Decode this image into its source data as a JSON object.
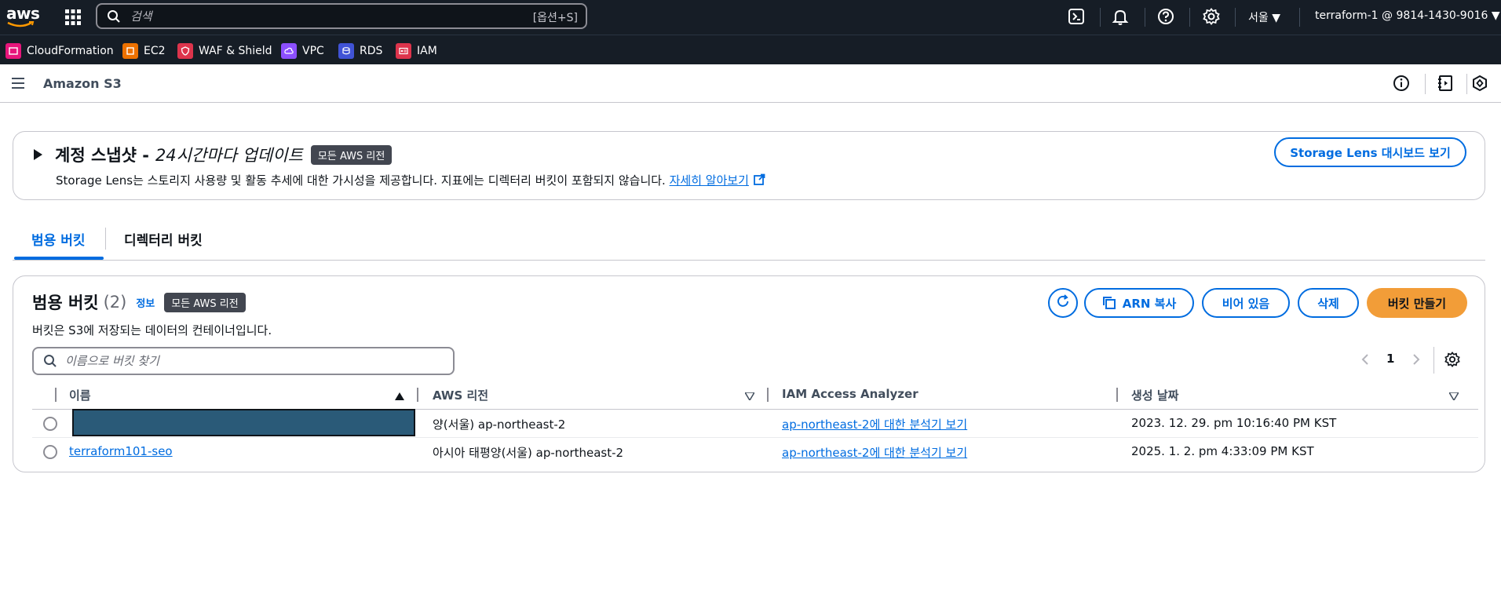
{
  "topnav": {
    "logo_text": "aws",
    "search_placeholder": "검색",
    "search_shortcut": "[옵션+S]",
    "region": "서울 ▼",
    "account": "terraform-1 @ 9814-1430-9016 ▼"
  },
  "favorites": [
    {
      "label": "CloudFormation",
      "color": "#e7157b"
    },
    {
      "label": "EC2",
      "color": "#ed7100"
    },
    {
      "label": "WAF & Shield",
      "color": "#dd344c"
    },
    {
      "label": "VPC",
      "color": "#8c4fff"
    },
    {
      "label": "RDS",
      "color": "#4053d6"
    },
    {
      "label": "IAM",
      "color": "#dd344c"
    }
  ],
  "service": {
    "title": "Amazon S3"
  },
  "snapshot": {
    "title_bold": "계정 스냅샷 -",
    "title_italic": "24시간마다 업데이트",
    "badge": "모든 AWS 리전",
    "description": "Storage Lens는 스토리지 사용량 및 활동 추세에 대한 가시성을 제공합니다. 지표에는 디렉터리 버킷이 포함되지 않습니다.",
    "learn_more": "자세히 알아보기",
    "dashboard_button": "Storage Lens 대시보드 보기"
  },
  "tabs": [
    {
      "label": "범용 버킷",
      "active": true
    },
    {
      "label": "디렉터리 버킷",
      "active": false
    }
  ],
  "buckets": {
    "title": "범용 버킷",
    "count": "(2)",
    "info": "정보",
    "badge": "모든 AWS 리전",
    "description": "버킷은 S3에 저장되는 데이터의 컨테이너입니다.",
    "find_placeholder": "이름으로 버킷 찾기",
    "buttons": {
      "copy_arn": "ARN 복사",
      "empty": "비어 있음",
      "delete": "삭제",
      "create": "버킷 만들기"
    },
    "page": "1",
    "columns": [
      "이름",
      "AWS 리전",
      "IAM Access Analyzer",
      "생성 날짜"
    ],
    "rows": [
      {
        "name": "",
        "region": "양(서울) ap-northeast-2",
        "analyzer": "ap-northeast-2에 대한 분석기 보기",
        "created": "2023. 12. 29. pm 10:16:40 PM KST"
      },
      {
        "name": "terraform101-seo",
        "region": "아시아 태평양(서울) ap-northeast-2",
        "analyzer": "ap-northeast-2에 대한 분석기 보기",
        "created": "2025. 1. 2. pm 4:33:09 PM KST"
      }
    ]
  },
  "colors": {
    "nav_bg": "#161d26",
    "link": "#006ce0",
    "primary_button": "#f29d38",
    "badge_bg": "#424650"
  }
}
